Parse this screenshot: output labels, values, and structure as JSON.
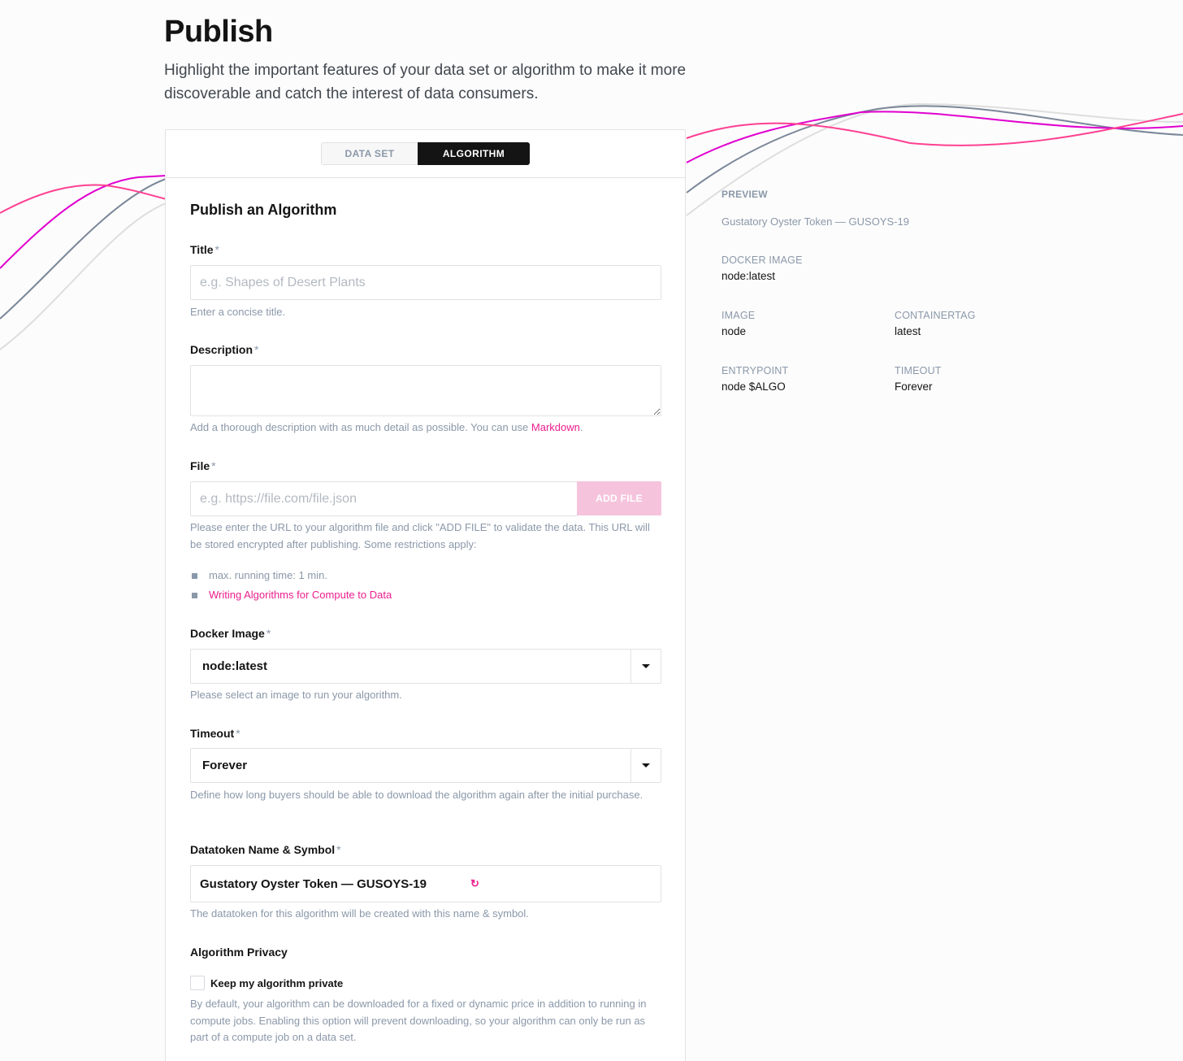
{
  "page": {
    "title": "Publish",
    "description": "Highlight the important features of your data set or algorithm to make it more discoverable and catch the interest of data consumers."
  },
  "tabs": [
    {
      "label": "DATA SET",
      "active": false
    },
    {
      "label": "ALGORITHM",
      "active": true
    }
  ],
  "form": {
    "title": "Publish an Algorithm",
    "required_marker": "*",
    "title_field": {
      "label": "Title",
      "placeholder": "e.g. Shapes of Desert Plants",
      "value": "",
      "help": "Enter a concise title."
    },
    "description_field": {
      "label": "Description",
      "value": "",
      "help_prefix": "Add a thorough description with as much detail as possible. You can use ",
      "help_link": "Markdown",
      "help_suffix": "."
    },
    "file_field": {
      "label": "File",
      "placeholder": "e.g. https://file.com/file.json",
      "value": "",
      "button": "ADD FILE",
      "help": "Please enter the URL to your algorithm file and click \"ADD FILE\" to validate the data. This URL will be stored encrypted after publishing. Some restrictions apply:",
      "bullets": [
        {
          "text": "max. running time: 1 min.",
          "link": false
        },
        {
          "text": "Writing Algorithms for Compute to Data",
          "link": true
        }
      ]
    },
    "docker_field": {
      "label": "Docker Image",
      "value": "node:latest",
      "help": "Please select an image to run your algorithm."
    },
    "timeout_field": {
      "label": "Timeout",
      "value": "Forever",
      "help": "Define how long buyers should be able to download the algorithm again after the initial purchase."
    },
    "datatoken_field": {
      "label": "Datatoken Name & Symbol",
      "value": "Gustatory Oyster Token — GUSOYS-19",
      "help": "The datatoken for this algorithm will be created with this name & symbol."
    },
    "privacy": {
      "label": "Algorithm Privacy",
      "checkbox_label": "Keep my algorithm private",
      "checked": false,
      "help": "By default, your algorithm can be downloaded for a fixed or dynamic price in addition to running in compute jobs. Enabling this option will prevent downloading, so your algorithm can only be run as part of a compute job on a data set."
    }
  },
  "preview": {
    "heading": "PREVIEW",
    "title": "Gustatory Oyster Token — GUSOYS-19",
    "docker_image_key": "DOCKER IMAGE",
    "docker_image_val": "node:latest",
    "image_key": "IMAGE",
    "image_val": "node",
    "containertag_key": "CONTAINERTAG",
    "containertag_val": "latest",
    "entrypoint_key": "ENTRYPOINT",
    "entrypoint_val": "node $ALGO",
    "timeout_key": "TIMEOUT",
    "timeout_val": "Forever"
  },
  "colors": {
    "accent": "#ec1e8e",
    "text": "#141414",
    "muted": "#8b98a9",
    "border": "#e2e2e2",
    "wave_magenta": "#e000cf",
    "wave_pink": "#ff4092",
    "wave_slate": "#7b8799",
    "wave_light": "#d8d8d8"
  },
  "icons": {
    "refresh": "refresh-icon",
    "caret": "chevron-down-icon",
    "bullet": "square-bullet-icon"
  }
}
